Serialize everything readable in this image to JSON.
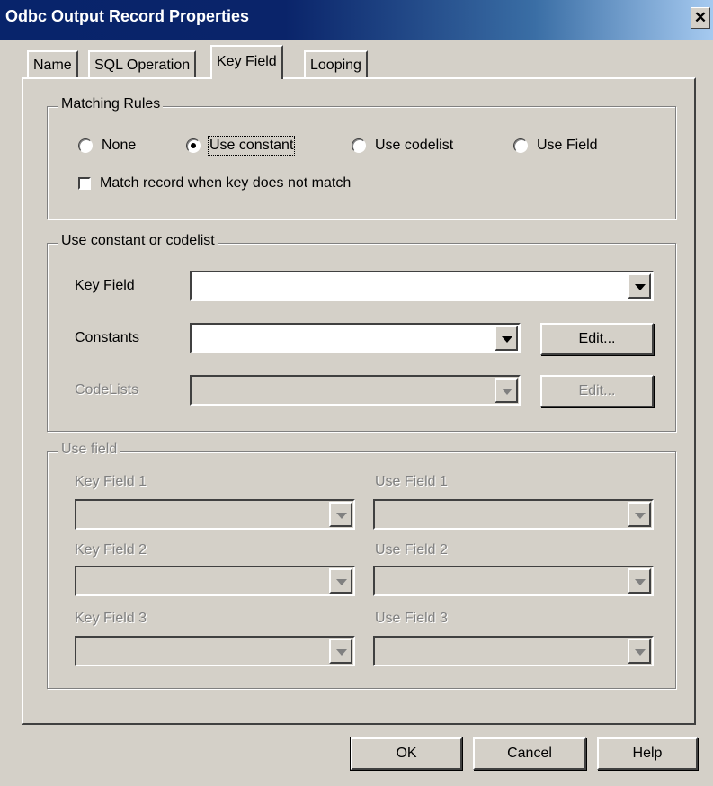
{
  "window": {
    "title": "Odbc Output Record Properties",
    "close_glyph": "✕"
  },
  "tabs": [
    {
      "label": "Name"
    },
    {
      "label": "SQL Operation"
    },
    {
      "label": "Key Field",
      "active": true
    },
    {
      "label": "Looping"
    }
  ],
  "matching_rules": {
    "legend": "Matching Rules",
    "options": [
      {
        "label": "None",
        "selected": false
      },
      {
        "label": "Use constant",
        "selected": true
      },
      {
        "label": "Use codelist",
        "selected": false
      },
      {
        "label": "Use Field",
        "selected": false
      }
    ],
    "checkbox": {
      "label": "Match record when key does not match",
      "checked": false
    }
  },
  "constant_codelist": {
    "legend": "Use constant or codelist",
    "key_field_label": "Key Field",
    "key_field_value": "",
    "constants_label": "Constants",
    "constants_value": "",
    "constants_edit": "Edit...",
    "codelists_label": "CodeLists",
    "codelists_value": "",
    "codelists_edit": "Edit..."
  },
  "use_field": {
    "legend": "Use field",
    "key_field_1": "Key Field 1",
    "use_field_1": "Use Field 1",
    "key_field_2": "Key Field 2",
    "use_field_2": "Use Field 2",
    "key_field_3": "Key Field 3",
    "use_field_3": "Use Field 3"
  },
  "buttons": {
    "ok": "OK",
    "cancel": "Cancel",
    "help": "Help"
  }
}
